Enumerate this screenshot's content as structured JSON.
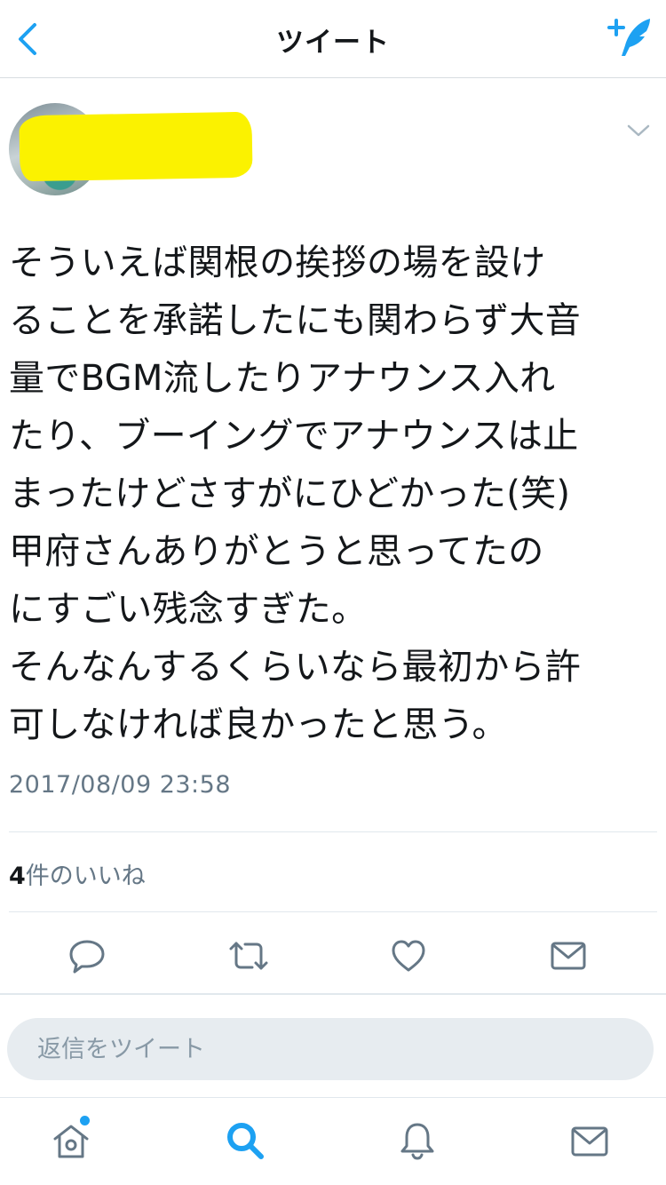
{
  "header": {
    "title": "ツイート",
    "back_icon": "chevron-left-icon",
    "compose_icon": "compose-tweet-icon",
    "accent_color": "#1da1f2"
  },
  "author": {
    "name": "",
    "handle": "",
    "redaction_color": "#fbf200"
  },
  "tweet": {
    "text": "そういえば関根の挨拶の場を設け\nることを承諾したにも関わらず大音\n量でBGM流したりアナウンス入れ\nたり、ブーイングでアナウンスは止\nまったけどさすがにひどかった(笑)\n甲府さんありがとうと思ってたの\nにすごい残念すぎた。\nそんなんするくらいなら最初から許\n可しなければ良かったと思う。",
    "timestamp": "2017/08/09 23:58",
    "likes_count": "4",
    "likes_label": "件のいいね"
  },
  "actions": [
    "reply-icon",
    "retweet-icon",
    "like-icon",
    "share-dm-icon"
  ],
  "reply": {
    "placeholder": "返信をツイート"
  },
  "tabbar": {
    "items": [
      "home-icon",
      "search-icon",
      "notifications-icon",
      "messages-icon"
    ],
    "active": "search-icon"
  }
}
